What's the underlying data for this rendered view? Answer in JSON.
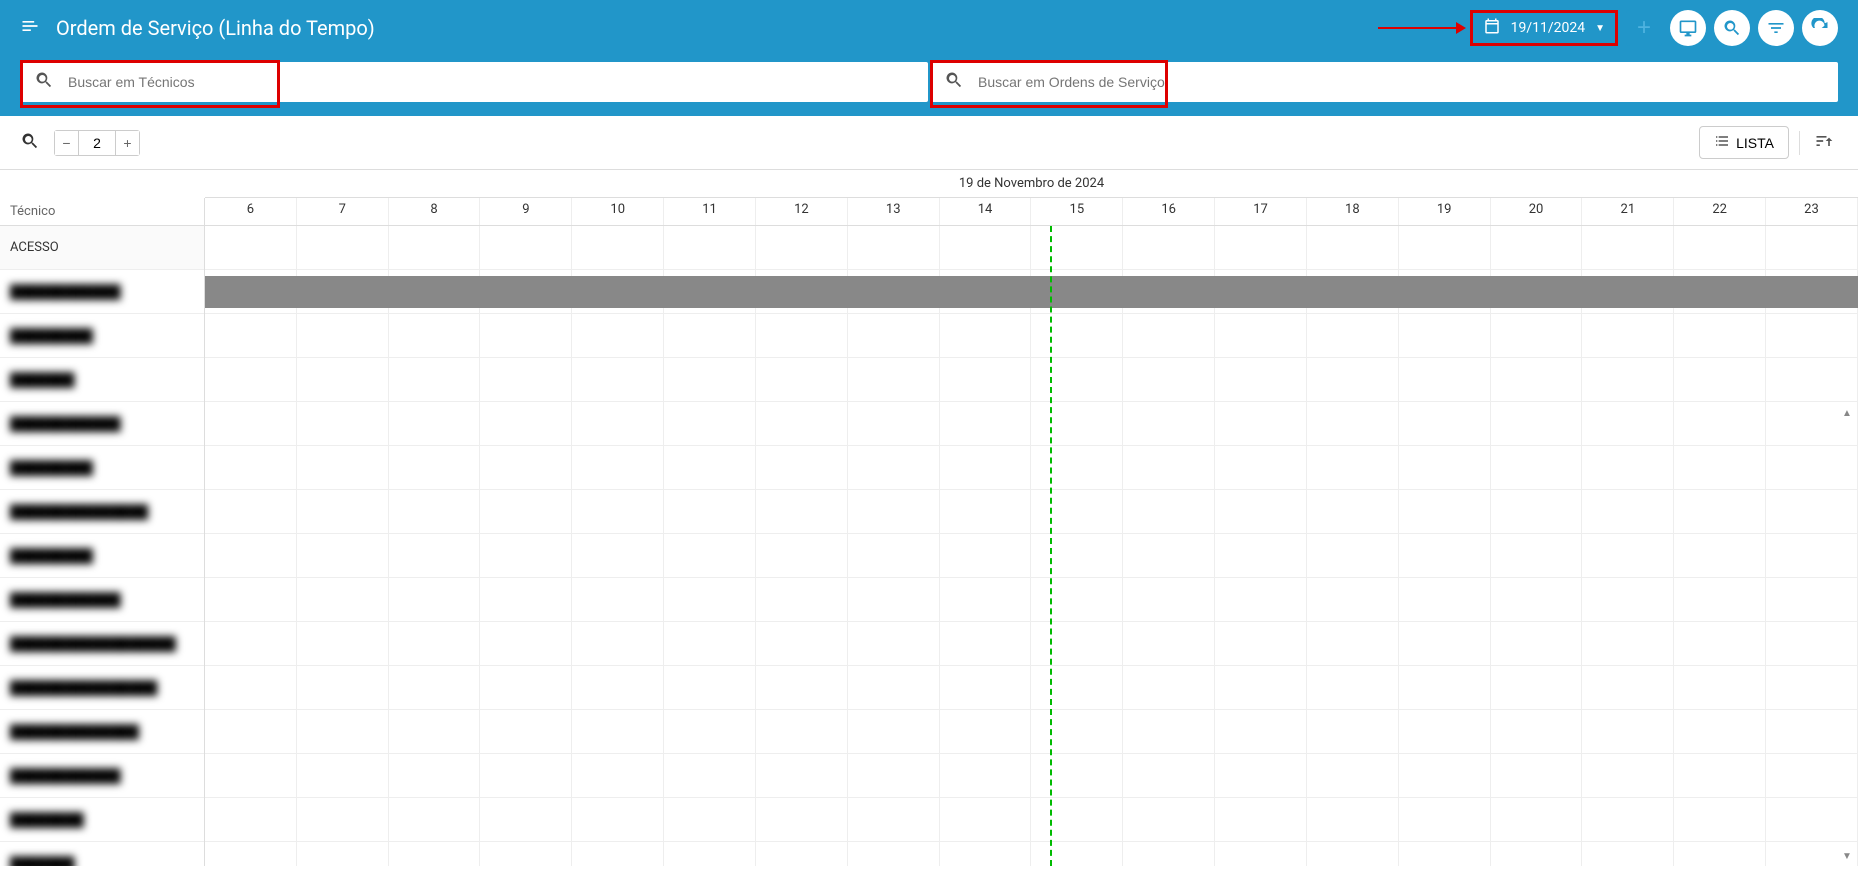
{
  "header": {
    "title": "Ordem de Serviço (Linha do Tempo)",
    "date": "19/11/2024"
  },
  "search": {
    "tech_placeholder": "Buscar em Técnicos",
    "order_placeholder": "Buscar em Ordens de Serviço"
  },
  "toolbar": {
    "zoom_value": "2",
    "list_button": "LISTA"
  },
  "timeline": {
    "date_label": "19 de Novembro de 2024",
    "tech_column_label": "Técnico",
    "hours": [
      "6",
      "7",
      "8",
      "9",
      "10",
      "11",
      "12",
      "13",
      "14",
      "15",
      "16",
      "17",
      "18",
      "19",
      "20",
      "21",
      "22",
      "23"
    ],
    "now_hour_fraction": 9.2,
    "groups": [
      {
        "name": "ACESSO"
      }
    ],
    "technicians": [
      {
        "name": "████████████",
        "has_task": true
      },
      {
        "name": "█████████",
        "has_task": false
      },
      {
        "name": "███████",
        "has_task": false
      },
      {
        "name": "████████████",
        "has_task": false
      },
      {
        "name": "█████████",
        "has_task": false
      },
      {
        "name": "███████████████",
        "has_task": false
      },
      {
        "name": "█████████",
        "has_task": false
      },
      {
        "name": "████████████",
        "has_task": false
      },
      {
        "name": "██████████████████",
        "has_task": false
      },
      {
        "name": "████████████████",
        "has_task": false
      },
      {
        "name": "██████████████",
        "has_task": false
      },
      {
        "name": "████████████",
        "has_task": false
      },
      {
        "name": "████████",
        "has_task": false
      },
      {
        "name": "███████",
        "has_task": false
      }
    ]
  }
}
